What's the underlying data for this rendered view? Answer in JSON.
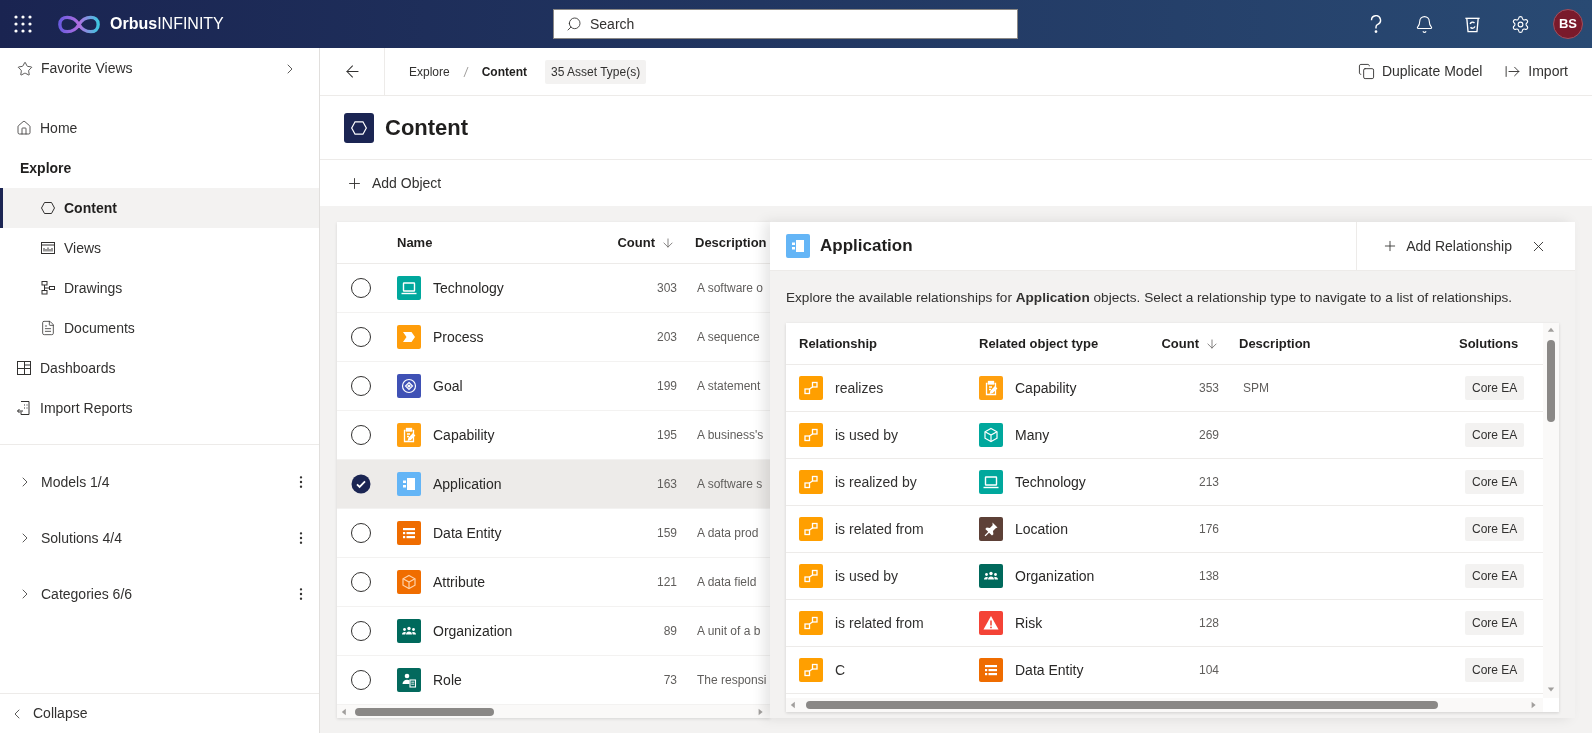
{
  "top_bar": {
    "logo_text": "**Orbus**INFINITY",
    "search": {
      "placeholder": "Search"
    },
    "avatar": "BS"
  },
  "sidebar": {
    "favorites": "Favorite Views",
    "items": [
      {
        "label": "Home",
        "selected": false
      },
      {
        "label": "Explore",
        "selected": false,
        "children": [
          {
            "label": "Content",
            "selected": true
          },
          {
            "label": "Views",
            "selected": false
          },
          {
            "label": "Drawings",
            "selected": false
          },
          {
            "label": "Documents",
            "selected": false
          }
        ]
      },
      {
        "label": "Dashboards",
        "selected": false
      },
      {
        "label": "Import Reports",
        "selected": false
      }
    ],
    "groups": [
      {
        "label": "Models 1/4",
        "expanded": false
      },
      {
        "label": "Solutions 4/4",
        "expanded": false
      },
      {
        "label": "Categories 6/6",
        "expanded": false
      }
    ],
    "collapse": "Collapse"
  },
  "breadcrumb": {
    "items": [
      {
        "label": "Explore",
        "current": false
      },
      {
        "label": "Content",
        "current": true
      }
    ],
    "count_badge": "35 Asset Type(s)",
    "actions": [
      "Duplicate Model",
      "Import"
    ]
  },
  "page": {
    "title": "Content",
    "add_button": "Add Object"
  },
  "content_table": {
    "columns": [
      {
        "label": "Name",
        "sorted": false
      },
      {
        "label": "Count",
        "sorted": true
      },
      {
        "label": "Description",
        "sorted": false
      }
    ],
    "rows": [
      {
        "name": "Technology",
        "kind": "technology",
        "color": "#00a89d",
        "count": "303",
        "description": "A software o",
        "selected": false
      },
      {
        "name": "Process",
        "kind": "process",
        "color": "#ff9d0a",
        "count": "203",
        "description": "A sequence",
        "selected": false
      },
      {
        "name": "Goal",
        "kind": "goal",
        "color": "#3f51b5",
        "count": "199",
        "description": "A statement",
        "selected": false
      },
      {
        "name": "Capability",
        "kind": "capability",
        "color": "#ffa00f",
        "count": "195",
        "description": "A business's",
        "selected": false
      },
      {
        "name": "Application",
        "kind": "application",
        "color": "#64b5f6",
        "count": "163",
        "description": "A software s",
        "selected": true
      },
      {
        "name": "Data Entity",
        "kind": "data_entity",
        "color": "#ef6c00",
        "count": "159",
        "description": "A data prod",
        "selected": false
      },
      {
        "name": "Attribute",
        "kind": "attribute",
        "color": "#f06d00",
        "count": "121",
        "description": "A data field",
        "selected": false
      },
      {
        "name": "Organization",
        "kind": "organization",
        "color": "#00695c",
        "count": "89",
        "description": "A unit of a b",
        "selected": false
      },
      {
        "name": "Role",
        "kind": "role",
        "color": "#03695d",
        "count": "73",
        "description": "The responsi",
        "selected": false
      }
    ]
  },
  "relationship_panel": {
    "title": "Application",
    "kind": "application",
    "color": "#64b5f6",
    "add_button": "Add Relationship",
    "intro": "Explore the available relationships for **Application** objects. Select a relationship type to navigate to a list of relationships.",
    "columns": [
      {
        "label": "Relationship",
        "sorted": false
      },
      {
        "label": "Related object type",
        "sorted": false
      },
      {
        "label": "Count",
        "sorted": true
      },
      {
        "label": "Description",
        "sorted": false
      },
      {
        "label": "Solutions",
        "sorted": false
      }
    ],
    "rows": [
      {
        "relationship": "realizes",
        "related": {
          "name": "Capability",
          "kind": "capability",
          "color": "#ffa00f"
        },
        "count": "353",
        "description": "SPM",
        "solutions": "Core EA"
      },
      {
        "relationship": "is used by",
        "related": {
          "name": "Many",
          "kind": "many",
          "color": "#00a89d"
        },
        "count": "269",
        "solutions": "Core EA"
      },
      {
        "relationship": "is realized by",
        "related": {
          "name": "Technology",
          "kind": "technology",
          "color": "#00a89d"
        },
        "count": "213",
        "solutions": "Core EA"
      },
      {
        "relationship": "is related from",
        "related": {
          "name": "Location",
          "kind": "location",
          "color": "#5d4037"
        },
        "count": "176",
        "solutions": "Core EA"
      },
      {
        "relationship": "is used by",
        "related": {
          "name": "Organization",
          "kind": "organization",
          "color": "#00695c"
        },
        "count": "138",
        "solutions": "Core EA"
      },
      {
        "relationship": "is related from",
        "related": {
          "name": "Risk",
          "kind": "risk",
          "color": "#f44336"
        },
        "count": "128",
        "solutions": "Core EA"
      },
      {
        "relationship": "C",
        "related": {
          "name": "Data Entity",
          "kind": "data_entity",
          "color": "#ef6c00"
        },
        "count": "104",
        "solutions": "Core EA"
      }
    ]
  }
}
